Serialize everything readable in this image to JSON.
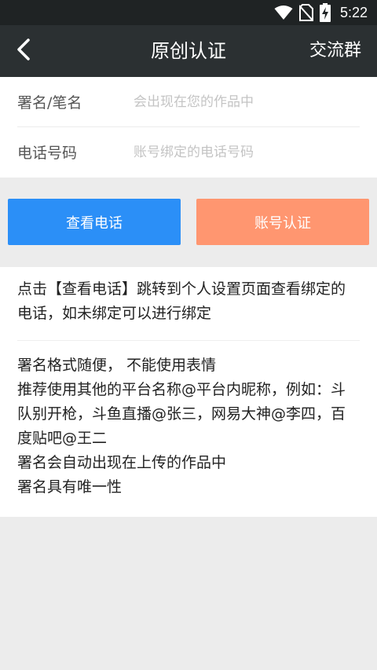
{
  "status_bar": {
    "time": "5:22"
  },
  "app_bar": {
    "back_icon": "chevron-left-icon",
    "title": "原创认证",
    "right_action": "交流群"
  },
  "form": {
    "signature": {
      "label": "署名/笔名",
      "placeholder": "会出现在您的作品中",
      "value": ""
    },
    "phone": {
      "label": "电话号码",
      "placeholder": "账号绑定的电话号码",
      "value": ""
    }
  },
  "buttons": {
    "view_phone": "查看电话",
    "verify_account": "账号认证"
  },
  "colors": {
    "blue_button": "#2b8ff7",
    "orange_button": "#ff9670",
    "app_bar": "#2b3032"
  },
  "info": {
    "paragraph1": "点击【查看电话】跳转到个人设置页面查看绑定的电话，如未绑定可以进行绑定",
    "lines": [
      "署名格式随便， 不能使用表情",
      "推荐使用其他的平台名称@平台内昵称，例如：斗队别开枪，斗鱼直播@张三，网易大神@李四，百度贴吧@王二",
      "署名会自动出现在上传的作品中",
      "署名具有唯一性"
    ]
  }
}
